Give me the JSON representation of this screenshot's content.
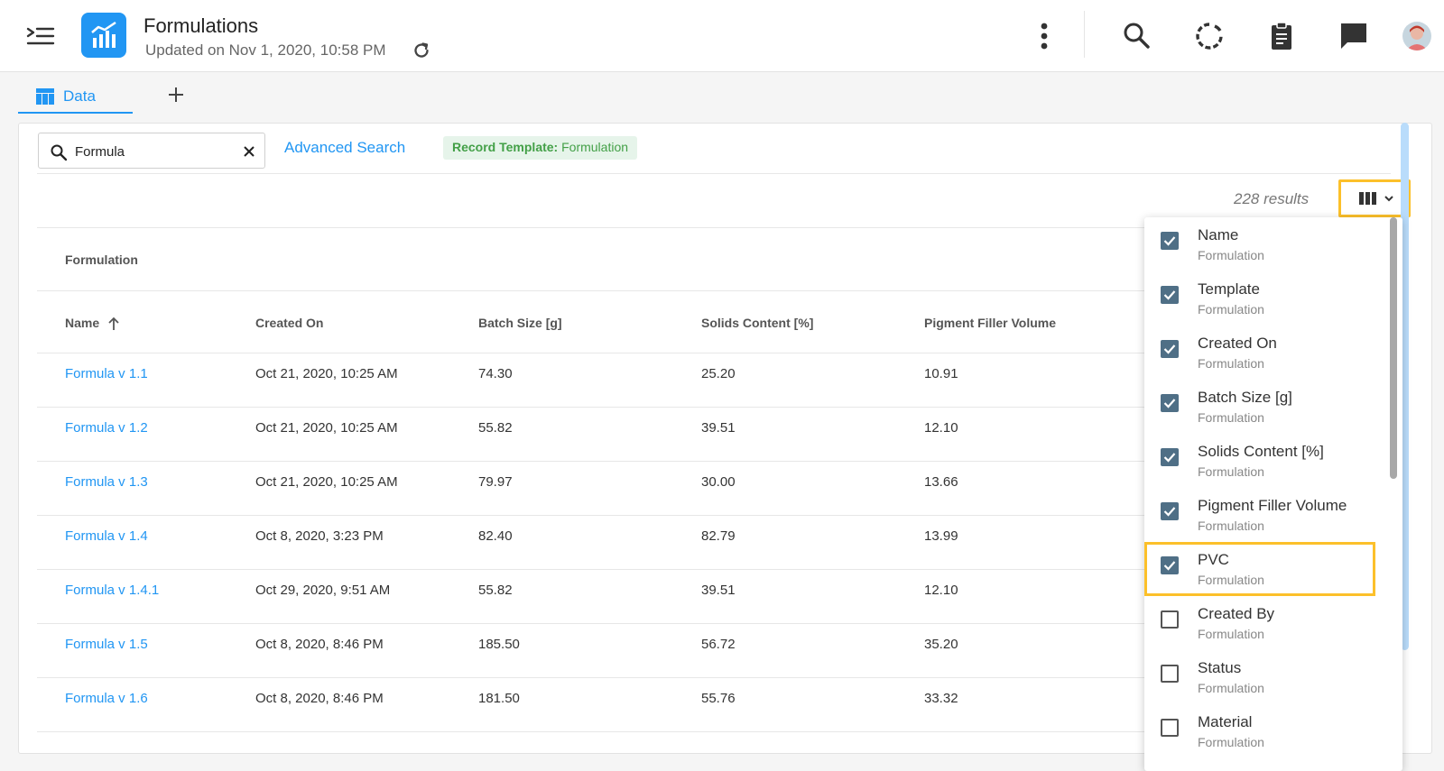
{
  "header": {
    "title": "Formulations",
    "updated": "Updated on Nov 1, 2020, 10:58 PM",
    "icons": [
      "menu-icon",
      "chart-icon",
      "refresh-icon",
      "more-vert-icon",
      "search-icon",
      "loading-icon",
      "clipboard-icon",
      "chat-icon",
      "avatar"
    ]
  },
  "tabs": [
    {
      "label": "Data",
      "icon": "table-icon"
    }
  ],
  "search": {
    "value": "Formula",
    "placeholder": "Search"
  },
  "toolbar": {
    "advanced_search": "Advanced Search",
    "template_label": "Record Template:",
    "template_value": "Formulation",
    "results": "228 results"
  },
  "table": {
    "group": "Formulation",
    "columns": [
      "Name",
      "Created On",
      "Batch Size [g]",
      "Solids Content [%]",
      "Pigment Filler Volume"
    ],
    "rows": [
      [
        "Formula v 1.1",
        "Oct 21, 2020, 10:25 AM",
        "74.30",
        "25.20",
        "10.91"
      ],
      [
        "Formula v 1.2",
        "Oct 21, 2020, 10:25 AM",
        "55.82",
        "39.51",
        "12.10"
      ],
      [
        "Formula v 1.3",
        "Oct 21, 2020, 10:25 AM",
        "79.97",
        "30.00",
        "13.66"
      ],
      [
        "Formula v 1.4",
        "Oct 8, 2020, 3:23 PM",
        "82.40",
        "82.79",
        "13.99"
      ],
      [
        "Formula v 1.4.1",
        "Oct 29, 2020, 9:51 AM",
        "55.82",
        "39.51",
        "12.10"
      ],
      [
        "Formula v 1.5",
        "Oct 8, 2020, 8:46 PM",
        "185.50",
        "56.72",
        "35.20"
      ],
      [
        "Formula v 1.6",
        "Oct 8, 2020, 8:46 PM",
        "181.50",
        "55.76",
        "33.32"
      ]
    ]
  },
  "columns_menu": {
    "options": [
      {
        "label": "Name",
        "sub": "Formulation",
        "checked": true
      },
      {
        "label": "Template",
        "sub": "Formulation",
        "checked": true
      },
      {
        "label": "Created On",
        "sub": "Formulation",
        "checked": true
      },
      {
        "label": "Batch Size [g]",
        "sub": "Formulation",
        "checked": true
      },
      {
        "label": "Solids Content [%]",
        "sub": "Formulation",
        "checked": true
      },
      {
        "label": "Pigment Filler Volume",
        "sub": "Formulation",
        "checked": true
      },
      {
        "label": "PVC",
        "sub": "Formulation",
        "checked": true
      },
      {
        "label": "Created By",
        "sub": "Formulation",
        "checked": false
      },
      {
        "label": "Status",
        "sub": "Formulation",
        "checked": false
      },
      {
        "label": "Material",
        "sub": "Formulation",
        "checked": false
      }
    ]
  },
  "colors": {
    "accent": "#2196f3",
    "highlight": "#fcc02a",
    "checkbox": "#4f6f86",
    "chip_bg": "#e6f4ea",
    "chip_text": "#43a047"
  }
}
